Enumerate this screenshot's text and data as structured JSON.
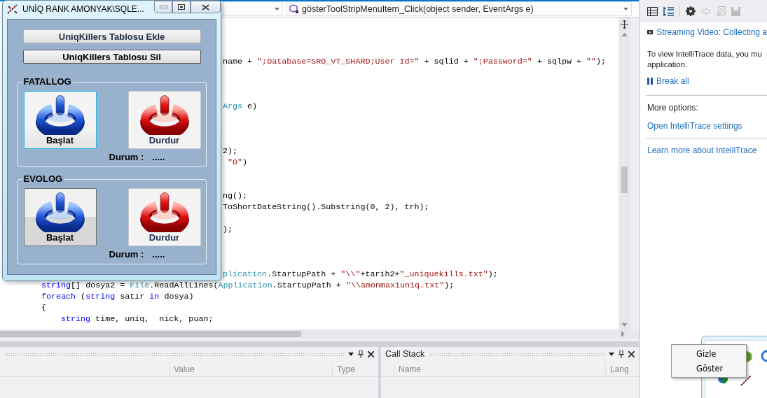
{
  "editor": {
    "member_dropdown": "gösterToolStripMenuItem_Click(object sender, EventArgs e)",
    "lines": [
      {
        "kind": "blank"
      },
      {
        "kind": "blank"
      },
      {
        "kind": "blank"
      },
      {
        "kind": "covered",
        "tokens": [
          {
            "kind": "plain",
            "text": "name + "
          },
          {
            "kind": "string",
            "text": "\";Database=SRO_VT_SHARD;User Id=\""
          },
          {
            "kind": "plain",
            "text": " + sqlid + "
          },
          {
            "kind": "string",
            "text": "\";Password=\""
          },
          {
            "kind": "plain",
            "text": " + sqlpw + "
          },
          {
            "kind": "string",
            "text": "\"\""
          },
          {
            "kind": "plain",
            "text": ");"
          }
        ]
      },
      {
        "kind": "blank"
      },
      {
        "kind": "blank"
      },
      {
        "kind": "blank"
      },
      {
        "kind": "covered",
        "tokens": [
          {
            "kind": "type",
            "text": "Args"
          },
          {
            "kind": "plain",
            "text": " e)"
          }
        ]
      },
      {
        "kind": "blank"
      },
      {
        "kind": "blank"
      },
      {
        "kind": "blank"
      },
      {
        "kind": "covered",
        "tokens": [
          {
            "kind": "plain",
            "text": "2);"
          }
        ]
      },
      {
        "kind": "covered",
        "tokens": [
          {
            "kind": "string",
            "text": " \"0\""
          },
          {
            "kind": "plain",
            "text": ")"
          }
        ]
      },
      {
        "kind": "blank"
      },
      {
        "kind": "blank"
      },
      {
        "kind": "covered",
        "tokens": [
          {
            "kind": "plain",
            "text": "ng();"
          }
        ]
      },
      {
        "kind": "covered",
        "tokens": [
          {
            "kind": "plain",
            "text": "ToShortDateString().Substring(0, 2), trh);"
          }
        ]
      },
      {
        "kind": "blank"
      },
      {
        "kind": "covered",
        "tokens": [
          {
            "kind": "plain",
            "text": ");"
          }
        ]
      },
      {
        "kind": "blank"
      },
      {
        "kind": "blank"
      },
      {
        "kind": "blank"
      },
      {
        "kind": "covered",
        "tokens": [
          {
            "kind": "type",
            "text": "plication"
          },
          {
            "kind": "plain",
            "text": ".StartupPath + "
          },
          {
            "kind": "string",
            "text": "\"\\\\\""
          },
          {
            "kind": "plain",
            "text": "+tarih2+"
          },
          {
            "kind": "string",
            "text": "\"_uniquekills.txt\""
          },
          {
            "kind": "plain",
            "text": ");"
          }
        ]
      },
      {
        "kind": "full",
        "tokens": [
          {
            "kind": "keyword",
            "text": "string"
          },
          {
            "kind": "plain",
            "text": "[] dosya2 = "
          },
          {
            "kind": "type",
            "text": "File"
          },
          {
            "kind": "plain",
            "text": ".ReadAllLines("
          },
          {
            "kind": "type",
            "text": "Application"
          },
          {
            "kind": "plain",
            "text": ".StartupPath + "
          },
          {
            "kind": "string",
            "text": "\"\\\\amonmaxiuniq.txt\""
          },
          {
            "kind": "plain",
            "text": ");"
          }
        ]
      },
      {
        "kind": "full",
        "tokens": [
          {
            "kind": "keyword",
            "text": "foreach"
          },
          {
            "kind": "plain",
            "text": " ("
          },
          {
            "kind": "keyword",
            "text": "string"
          },
          {
            "kind": "plain",
            "text": " satır "
          },
          {
            "kind": "keyword",
            "text": "in"
          },
          {
            "kind": "plain",
            "text": " dosya)"
          }
        ]
      },
      {
        "kind": "full",
        "tokens": [
          {
            "kind": "plain",
            "text": "{"
          }
        ]
      },
      {
        "kind": "nested",
        "tokens": [
          {
            "kind": "keyword",
            "text": "string"
          },
          {
            "kind": "plain",
            "text": " time, uniq,  nick, puan;"
          }
        ]
      }
    ]
  },
  "bottom_panels": [
    {
      "columns": [
        "Value",
        "Type"
      ]
    },
    {
      "title": "Call Stack",
      "columns": [
        "Name",
        "Lang"
      ]
    }
  ],
  "intellitrace": {
    "video_link": "Streaming Video: Collecting a",
    "message_lines": [
      "To view IntelliTrace data, you mu",
      "application."
    ],
    "break_link": "Break all",
    "options_label": "More options:",
    "settings_link": "Open IntelliTrace settings",
    "learn_link": "Learn more about IntelliTrace"
  },
  "dialog": {
    "title": "UNİQ RANK   AMONYAK\\SQLE...",
    "top_buttons": [
      {
        "label": "UniqKillers Tablosu Ekle",
        "default": false
      },
      {
        "label": "UniqKillers Tablosu Sil",
        "default": true
      }
    ],
    "groups": [
      {
        "title": "FATALLOG",
        "buttons": [
          {
            "label": "Başlat",
            "kind": "start",
            "focused": true
          },
          {
            "label": "Durdur",
            "kind": "stop",
            "focused": false
          }
        ],
        "status_label": "Durum :",
        "status_value": "....."
      },
      {
        "title": "EVOLOG",
        "buttons": [
          {
            "label": "Başlat",
            "kind": "start",
            "focused": false
          },
          {
            "label": "Durdur",
            "kind": "stop",
            "focused": false
          }
        ],
        "status_label": "Durum :",
        "status_value": "....."
      }
    ]
  },
  "context_menu": [
    "Gizle",
    "Göster"
  ]
}
